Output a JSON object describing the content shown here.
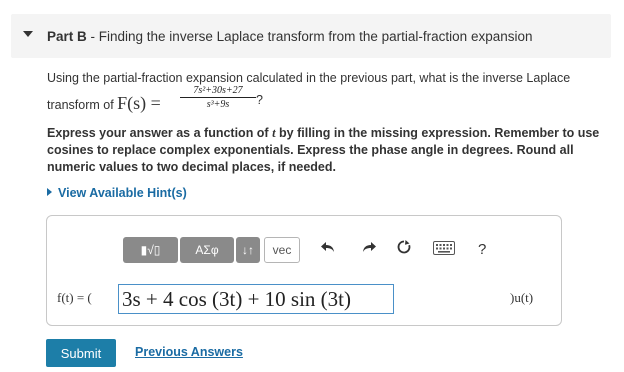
{
  "part": {
    "label": "Part B",
    "separator": " - ",
    "title": "Finding the inverse Laplace transform from the partial-fraction expansion"
  },
  "question": {
    "line1": "Using the partial-fraction expansion calculated in the previous part, what is the inverse Laplace",
    "line2_prefix": "transform of ",
    "func": "F(s) =",
    "numerator": "7s²+30s+27",
    "denominator": "s³+9s",
    "suffix": "?"
  },
  "instructions": {
    "p1": "Express your answer as a function of ",
    "var": "t",
    "p2": " by filling in the missing expression. Remember to use cosines to replace complex exponentials. Express the phase angle in degrees. Round all numeric values to two decimal places, if needed."
  },
  "hint_link": "View Available Hint(s)",
  "toolbar": {
    "templates_label": "▮√▯",
    "greek_label": "ΑΣφ",
    "arrows_label": "↓↑",
    "vec_label": "vec",
    "help_label": "?"
  },
  "answer": {
    "prefix": "f(t) = (",
    "value": "3s + 4 cos (3t) + 10 sin (3t)",
    "suffix": ")u(t)"
  },
  "buttons": {
    "submit": "Submit",
    "previous_answers": "Previous Answers"
  }
}
